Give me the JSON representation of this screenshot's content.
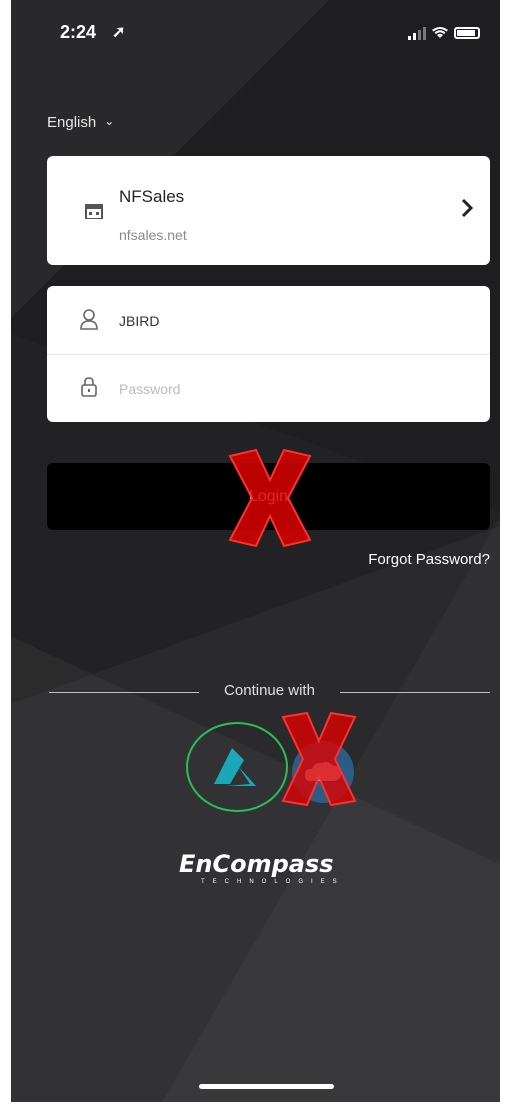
{
  "status_bar": {
    "time": "2:24",
    "location_icon": "location-arrow-icon",
    "signal_icon": "signal-icon",
    "wifi_icon": "wifi-icon",
    "battery_icon": "battery-icon"
  },
  "language": {
    "label": "English",
    "chevron_icon": "chevron-down-icon"
  },
  "site": {
    "name": "NFSales",
    "url": "nfsales.net",
    "icon": "building-icon",
    "arrow_icon": "chevron-right-icon"
  },
  "credentials": {
    "username_icon": "user-icon",
    "username_value": "JBIRD",
    "password_icon": "lock-icon",
    "password_placeholder": "Password"
  },
  "login_label": "Login",
  "forgot_label": "Forgot Password?",
  "continue_label": "Continue with",
  "sso": [
    {
      "name": "azure",
      "icon": "azure-icon"
    },
    {
      "name": "salesforce",
      "icon": "salesforce-icon"
    }
  ],
  "brand": {
    "name": "EnCompass",
    "sub": "TECHNOLOGIES"
  },
  "colors": {
    "background": "#2a2a2c",
    "button": "#000000",
    "x_mark": "#e00000",
    "circle": "#2bbd5a"
  }
}
